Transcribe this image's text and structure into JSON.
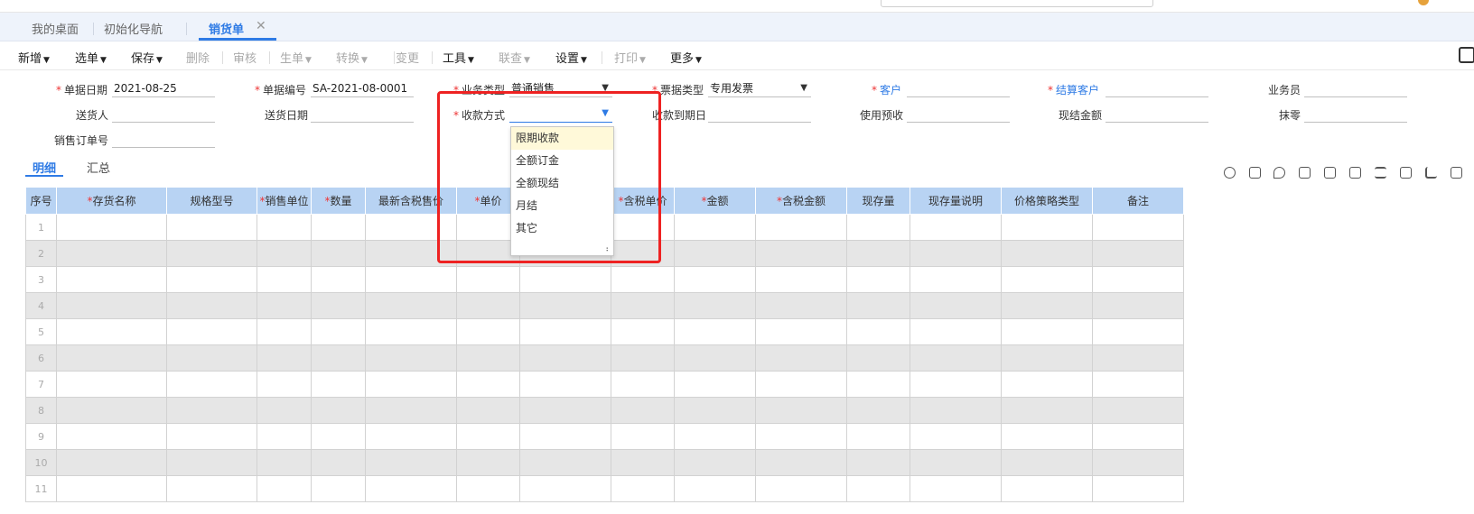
{
  "tabs": {
    "desktop": "我的桌面",
    "init_nav": "初始化导航",
    "active": "销货单",
    "close": "✕"
  },
  "toolbar": {
    "new": "新增",
    "select": "选单",
    "save": "保存",
    "delete": "删除",
    "audit": "审核",
    "generate": "生单",
    "convert": "转换",
    "change": "变更",
    "tools": "工具",
    "query": "联查",
    "settings": "设置",
    "print": "打印",
    "more": "更多"
  },
  "form": {
    "doc_date_label": "单据日期",
    "doc_date": "2021-08-25",
    "doc_no_label": "单据编号",
    "doc_no": "SA-2021-08-0001",
    "biz_type_label": "业务类型",
    "biz_type": "普通销售",
    "invoice_type_label": "票据类型",
    "invoice_type": "专用发票",
    "customer_label": "客户",
    "settle_customer_label": "结算客户",
    "salesman_label": "业务员",
    "deliverer_label": "送货人",
    "delivery_date_label": "送货日期",
    "payment_method_label": "收款方式",
    "payment_due_label": "收款到期日",
    "use_prepay_label": "使用预收",
    "cash_amount_label": "现结金额",
    "round_off_label": "抹零",
    "sales_order_label": "销售订单号"
  },
  "subtabs": {
    "detail": "明细",
    "summary": "汇总"
  },
  "grid": {
    "headers": [
      "序号",
      "存货名称",
      "规格型号",
      "销售单位",
      "数量",
      "最新含税售价",
      "单价",
      "",
      "含税单价",
      "金额",
      "含税金额",
      "现存量",
      "现存量说明",
      "价格策略类型",
      "备注"
    ],
    "required": [
      false,
      true,
      false,
      true,
      true,
      false,
      true,
      false,
      true,
      true,
      true,
      false,
      false,
      false,
      false
    ],
    "rows": [
      "1",
      "2",
      "3",
      "4",
      "5",
      "6",
      "7",
      "8",
      "9",
      "10",
      "11"
    ]
  },
  "dropdown": {
    "options": [
      "限期收款",
      "全额订金",
      "全额现结",
      "月结",
      "其它"
    ],
    "selected_index": 0
  },
  "colors": {
    "accent": "#2f7be5",
    "required": "#e33333",
    "highlight": "#ee2222",
    "header_bg": "#b8d3f3",
    "row_alt": "#e6e6e6"
  }
}
